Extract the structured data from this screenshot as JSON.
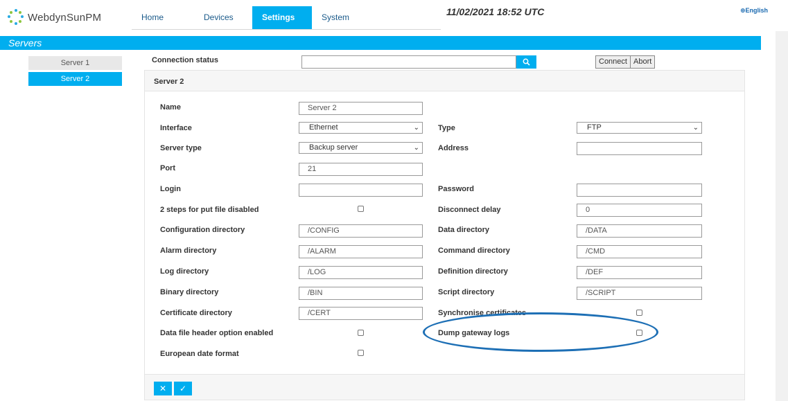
{
  "app": {
    "name": "WebdynSunPM"
  },
  "nav": {
    "items": [
      "Home",
      "Devices",
      "Settings",
      "System"
    ],
    "active": "Settings"
  },
  "header": {
    "datetime": "11/02/2021 18:52 UTC",
    "language": "English"
  },
  "section": {
    "title": "Servers"
  },
  "sidebar": {
    "items": [
      {
        "label": "Server 1",
        "active": false
      },
      {
        "label": "Server 2",
        "active": true
      }
    ]
  },
  "connection": {
    "label": "Connection status",
    "value": "",
    "connect_label": "Connect",
    "abort_label": "Abort"
  },
  "panel": {
    "title": "Server 2",
    "fields": {
      "name": {
        "label": "Name",
        "value": "Server 2"
      },
      "interface": {
        "label": "Interface",
        "value": "Ethernet"
      },
      "type": {
        "label": "Type",
        "value": "FTP"
      },
      "server_type": {
        "label": "Server type",
        "value": "Backup server"
      },
      "address": {
        "label": "Address",
        "value": ""
      },
      "port": {
        "label": "Port",
        "value": "21"
      },
      "login": {
        "label": "Login",
        "value": ""
      },
      "password": {
        "label": "Password",
        "value": ""
      },
      "two_steps": {
        "label": "2 steps for put file disabled",
        "checked": false
      },
      "disconnect_delay": {
        "label": "Disconnect delay",
        "value": "0"
      },
      "config_dir": {
        "label": "Configuration directory",
        "value": "/CONFIG"
      },
      "data_dir": {
        "label": "Data directory",
        "value": "/DATA"
      },
      "alarm_dir": {
        "label": "Alarm directory",
        "value": "/ALARM"
      },
      "command_dir": {
        "label": "Command directory",
        "value": "/CMD"
      },
      "log_dir": {
        "label": "Log directory",
        "value": "/LOG"
      },
      "definition_dir": {
        "label": "Definition directory",
        "value": "/DEF"
      },
      "binary_dir": {
        "label": "Binary directory",
        "value": "/BIN"
      },
      "script_dir": {
        "label": "Script directory",
        "value": "/SCRIPT"
      },
      "certificate_dir": {
        "label": "Certificate directory",
        "value": "/CERT"
      },
      "sync_certs": {
        "label": "Synchronise certificates",
        "checked": false
      },
      "data_header": {
        "label": "Data file header option enabled",
        "checked": false
      },
      "dump_logs": {
        "label": "Dump gateway logs",
        "checked": false
      },
      "european_date": {
        "label": "European date format",
        "checked": false
      }
    }
  },
  "colors": {
    "accent": "#00aeef",
    "highlight": "#1d6fb5"
  }
}
